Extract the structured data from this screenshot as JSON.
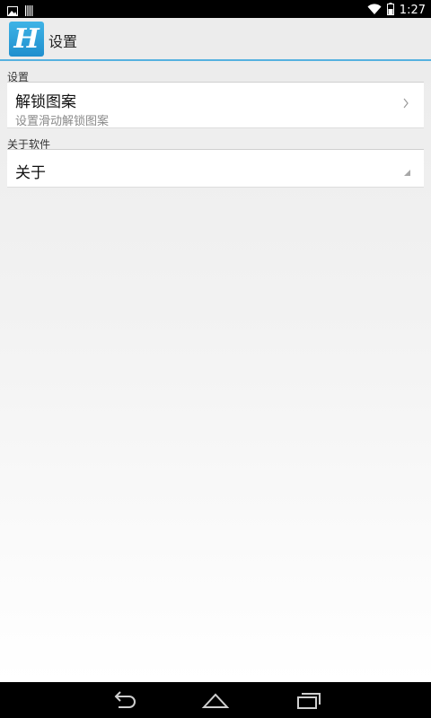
{
  "status_bar": {
    "time": "1:27",
    "icons": [
      "image-icon",
      "barcode-icon",
      "wifi-icon",
      "battery-icon"
    ]
  },
  "action_bar": {
    "logo_letter": "H",
    "title": "设置",
    "accent": "#55b1df"
  },
  "sections": [
    {
      "header": "设置",
      "items": [
        {
          "title": "解锁图案",
          "summary": "设置滑动解锁图案",
          "indicator": "chevron-right-icon"
        }
      ]
    },
    {
      "header": "关于软件",
      "items": [
        {
          "title": "关于",
          "indicator": "corner-triangle-icon"
        }
      ]
    }
  ],
  "nav_bar": {
    "buttons": [
      "back-icon",
      "home-icon",
      "recents-icon"
    ]
  }
}
